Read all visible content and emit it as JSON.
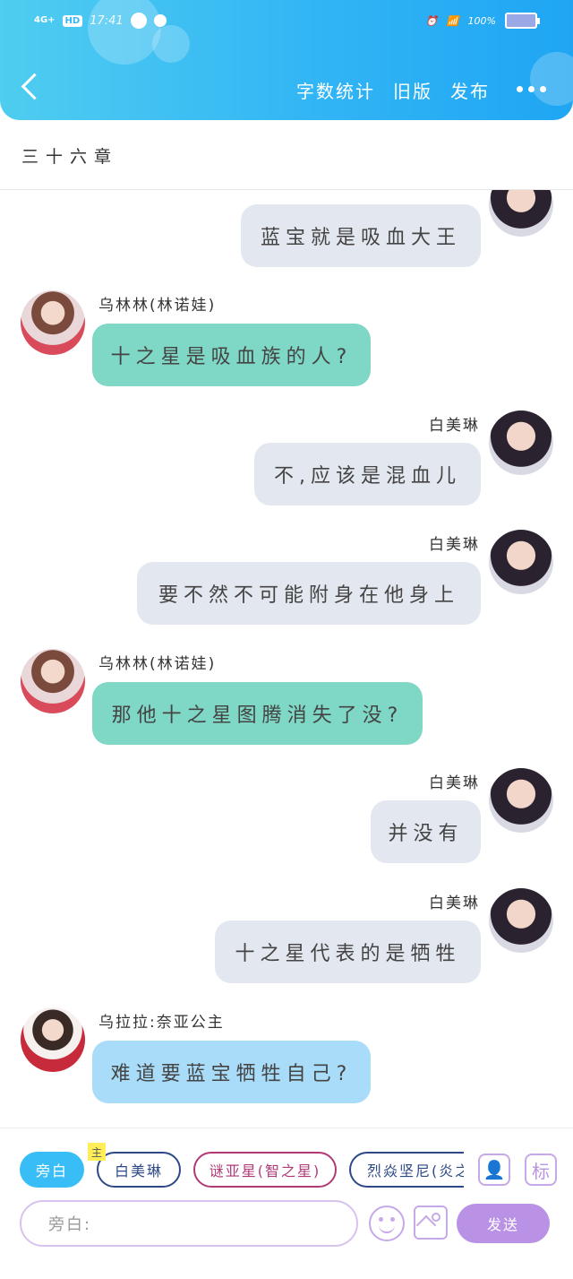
{
  "status_bar": {
    "network": "4G+",
    "hd": "HD",
    "time": "17:41",
    "battery": "100%"
  },
  "header": {
    "back_icon": "chevron-left-icon",
    "actions": [
      "字数统计",
      "旧版",
      "发布"
    ],
    "more_icon": "more-dots-icon"
  },
  "chapter": {
    "title": "三十六章"
  },
  "messages": [
    {
      "side": "right",
      "name": "",
      "text": "蓝宝就是吸血大王",
      "color": "#e3e7ef"
    },
    {
      "side": "left",
      "name": "乌林林(林诺娃)",
      "text": "十之星是吸血族的人?",
      "color": "#7fd7c6"
    },
    {
      "side": "right",
      "name": "白美琳",
      "text": "不,应该是混血儿",
      "color": "#e3e7ef"
    },
    {
      "side": "right",
      "name": "白美琳",
      "text": "要不然不可能附身在他身上",
      "color": "#e3e7ef"
    },
    {
      "side": "left",
      "name": "乌林林(林诺娃)",
      "text": "那他十之星图腾消失了没?",
      "color": "#7fd7c6"
    },
    {
      "side": "right",
      "name": "白美琳",
      "text": "并没有",
      "color": "#e3e7ef"
    },
    {
      "side": "right",
      "name": "白美琳",
      "text": "十之星代表的是牺牲",
      "color": "#e3e7ef"
    },
    {
      "side": "left",
      "name": "乌拉拉:奈亚公主",
      "text": "难道要蓝宝牺牲自己?",
      "color": "#a8dcf8"
    }
  ],
  "composer": {
    "role_chips": [
      {
        "label": "旁白",
        "active": true
      },
      {
        "label": "白美琳",
        "badge": "主"
      },
      {
        "label": "谜亚星(智之星)"
      },
      {
        "label": "烈焱坚尼(炎之"
      }
    ],
    "role_icon": "person-card-icon",
    "mark_label": "标",
    "placeholder": "旁白:",
    "emoji_icon": "emoji-icon",
    "image_icon": "image-icon",
    "send_label": "发送"
  }
}
